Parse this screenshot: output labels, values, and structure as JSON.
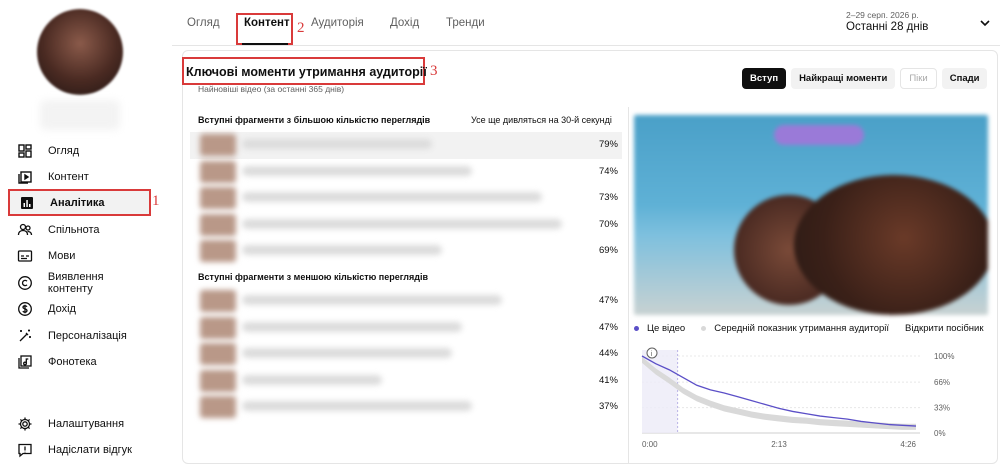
{
  "sidebar": {
    "items": [
      {
        "label": "Огляд",
        "icon": "dashboard-icon"
      },
      {
        "label": "Контент",
        "icon": "content-icon"
      },
      {
        "label": "Аналітика",
        "icon": "analytics-icon",
        "active": true
      },
      {
        "label": "Спільнота",
        "icon": "community-icon"
      },
      {
        "label": "Мови",
        "icon": "subtitles-icon"
      },
      {
        "label": "Виявлення контенту",
        "icon": "copyright-icon"
      },
      {
        "label": "Дохід",
        "icon": "dollar-icon"
      },
      {
        "label": "Персоналізація",
        "icon": "magic-wand-icon"
      },
      {
        "label": "Фонотека",
        "icon": "audio-library-icon"
      }
    ],
    "bottom": [
      {
        "label": "Налаштування",
        "icon": "gear-icon"
      },
      {
        "label": "Надіслати відгук",
        "icon": "feedback-icon"
      }
    ],
    "marker": "1"
  },
  "tabs": {
    "items": [
      "Огляд",
      "Контент",
      "Аудиторія",
      "Дохід",
      "Тренди"
    ],
    "active": "Контент",
    "marker": "2"
  },
  "date_range": {
    "range": "2–29 серп. 2026 р.",
    "label": "Останні 28 днів"
  },
  "section": {
    "title": "Ключові моменти утримання аудиторії",
    "subtitle": "Найновіші відео (за останні 365 днів)",
    "marker": "3",
    "filters": [
      {
        "label": "Вступ",
        "state": "active"
      },
      {
        "label": "Найкращі моменти",
        "state": "normal"
      },
      {
        "label": "Піки",
        "state": "disabled"
      },
      {
        "label": "Спади",
        "state": "normal"
      }
    ]
  },
  "high_list": {
    "header": "Вступні фрагменти з більшою кількістю переглядів",
    "right_header": "Усе ще дивляться на 30-й секунді",
    "rows": [
      "79%",
      "74%",
      "73%",
      "70%",
      "69%"
    ]
  },
  "low_list": {
    "header": "Вступні фрагменти з меншою кількістю переглядів",
    "rows": [
      "47%",
      "47%",
      "44%",
      "41%",
      "37%"
    ]
  },
  "legend": {
    "this_video": "Це відео",
    "average": "Середній показник утримання аудиторії",
    "guide": "Відкрити посібник"
  },
  "colors": {
    "accent": "#5b4fc7",
    "average_band": "#d9d9d9",
    "annotation": "#d93a3a"
  },
  "chart_data": {
    "type": "line",
    "x_tick_labels": [
      "0:00",
      "2:13",
      "4:26"
    ],
    "y_tick_labels": [
      "100%",
      "66%",
      "33%",
      "0%"
    ],
    "ylim": [
      0,
      100
    ],
    "series": [
      {
        "name": "Це відео",
        "x": [
          0,
          0.05,
          0.1,
          0.15,
          0.2,
          0.25,
          0.3,
          0.35,
          0.4,
          0.45,
          0.5,
          0.55,
          0.6,
          0.65,
          0.7,
          0.75,
          0.8,
          0.85,
          0.9,
          0.95,
          1.0
        ],
        "values": [
          100,
          90,
          82,
          72,
          62,
          56,
          52,
          47,
          42,
          37,
          32,
          28,
          25,
          22,
          20,
          18,
          15,
          13,
          11,
          10,
          9
        ]
      },
      {
        "name": "Середній показник утримання аудиторії",
        "x": [
          0,
          0.05,
          0.1,
          0.15,
          0.2,
          0.25,
          0.3,
          0.35,
          0.4,
          0.45,
          0.5,
          0.55,
          0.6,
          0.65,
          0.7,
          0.75,
          0.8,
          0.85,
          0.9,
          0.95,
          1.0
        ],
        "values": [
          95,
          80,
          68,
          55,
          45,
          38,
          32,
          28,
          24,
          21,
          19,
          17,
          16,
          14,
          13,
          12,
          11,
          10,
          9,
          8,
          8
        ]
      }
    ],
    "intro_highlight": [
      0,
      0.13
    ],
    "grid": true,
    "legend": "top"
  }
}
